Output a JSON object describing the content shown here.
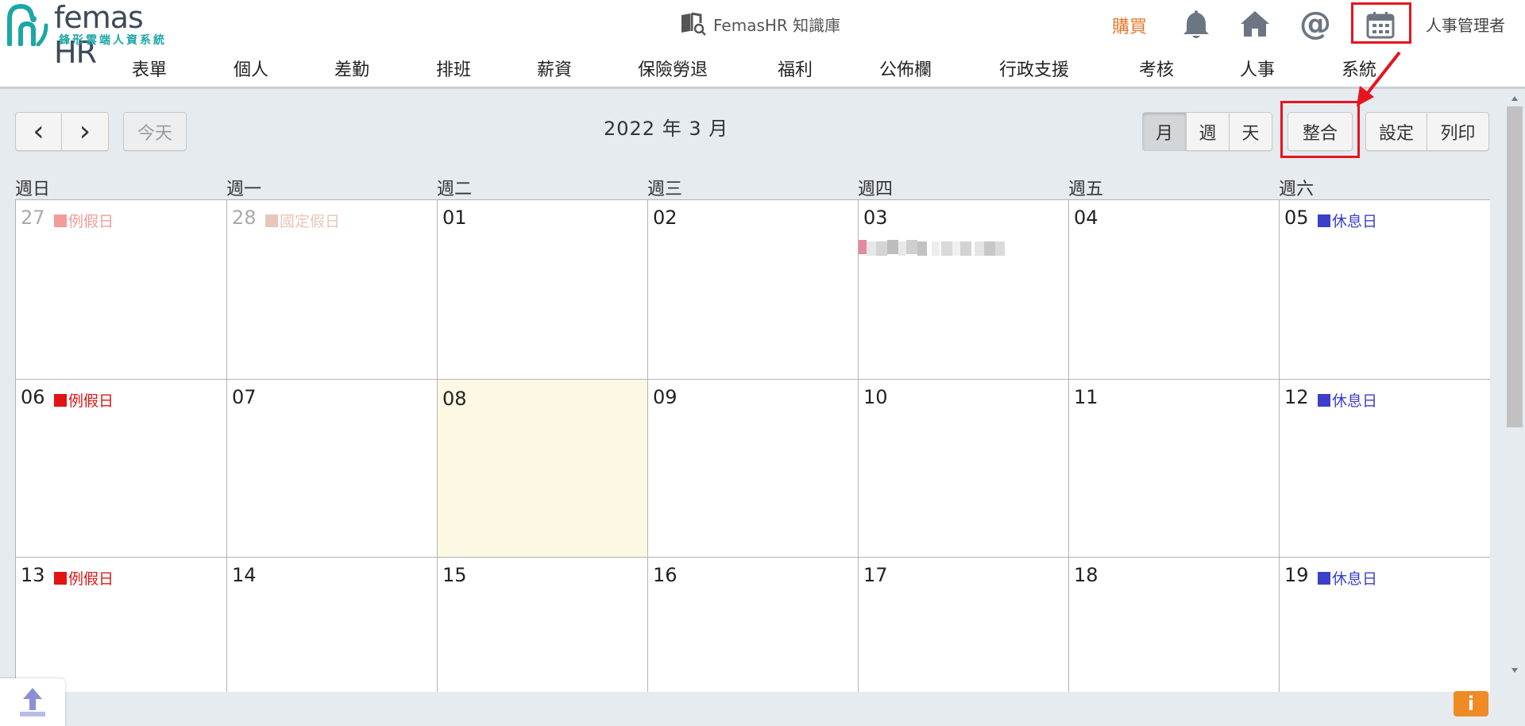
{
  "header": {
    "logo_text": "femas HR",
    "logo_sub": "鋒形雲端人資系統",
    "kb_label": "FemasHR 知識庫",
    "buy_label": "購買",
    "user_label": "人事管理者"
  },
  "nav": {
    "items": [
      "表單",
      "個人",
      "差勤",
      "排班",
      "薪資",
      "保險勞退",
      "福利",
      "公佈欄",
      "行政支援",
      "考核",
      "人事",
      "系統"
    ]
  },
  "toolbar": {
    "prev_label": "‹",
    "next_label": "›",
    "today_label": "今天",
    "title": "2022 年 3 月",
    "view_month": "月",
    "view_week": "週",
    "view_day": "天",
    "integrate_label": "整合",
    "settings_label": "設定",
    "print_label": "列印"
  },
  "calendar": {
    "weekdays": [
      "週日",
      "週一",
      "週二",
      "週三",
      "週四",
      "週五",
      "週六"
    ],
    "rows": [
      [
        {
          "day": "27",
          "event": "例假日",
          "event_color": "#f59a9a",
          "other": true
        },
        {
          "day": "28",
          "event": "國定假日",
          "event_color": "#e8c6b8",
          "other": true
        },
        {
          "day": "01"
        },
        {
          "day": "02"
        },
        {
          "day": "03",
          "blurred_event": true
        },
        {
          "day": "04"
        },
        {
          "day": "05",
          "event": "休息日",
          "event_color": "#3b3fc9"
        }
      ],
      [
        {
          "day": "06",
          "event": "例假日",
          "event_color": "#e11414"
        },
        {
          "day": "07"
        },
        {
          "day": "08",
          "today": true
        },
        {
          "day": "09"
        },
        {
          "day": "10"
        },
        {
          "day": "11"
        },
        {
          "day": "12",
          "event": "休息日",
          "event_color": "#3b3fc9"
        }
      ],
      [
        {
          "day": "13",
          "event": "例假日",
          "event_color": "#e11414"
        },
        {
          "day": "14"
        },
        {
          "day": "15"
        },
        {
          "day": "16"
        },
        {
          "day": "17"
        },
        {
          "day": "18"
        },
        {
          "day": "19",
          "event": "休息日",
          "event_color": "#3b3fc9"
        }
      ]
    ]
  },
  "footer": {
    "info_label": "i"
  }
}
